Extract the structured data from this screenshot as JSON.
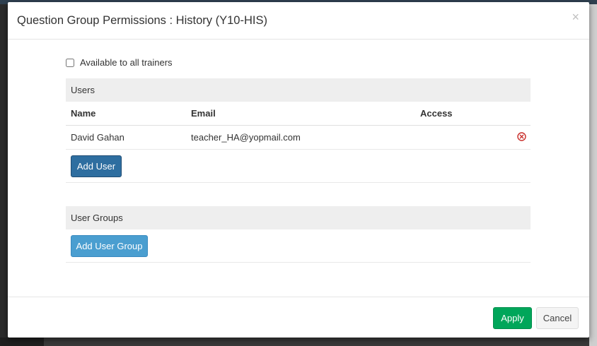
{
  "modal": {
    "title": "Question Group Permissions : History (Y10-HIS)",
    "close_label": "×",
    "available_checkbox": {
      "label": "Available to all trainers",
      "checked": false
    },
    "users_panel": {
      "heading": "Users",
      "columns": [
        "Name",
        "Email",
        "Access"
      ],
      "rows": [
        {
          "name": "David Gahan",
          "email": "teacher_HA@yopmail.com",
          "access": ""
        }
      ],
      "add_button": "Add User"
    },
    "groups_panel": {
      "heading": "User Groups",
      "add_button": "Add User Group"
    },
    "footer": {
      "apply_label": "Apply",
      "cancel_label": "Cancel"
    }
  },
  "colors": {
    "primary": "#2e6ea0",
    "info": "#4a9ed0",
    "success": "#00a65a",
    "danger": "#c9302c"
  },
  "icons": {
    "remove": "remove-circle-icon"
  }
}
